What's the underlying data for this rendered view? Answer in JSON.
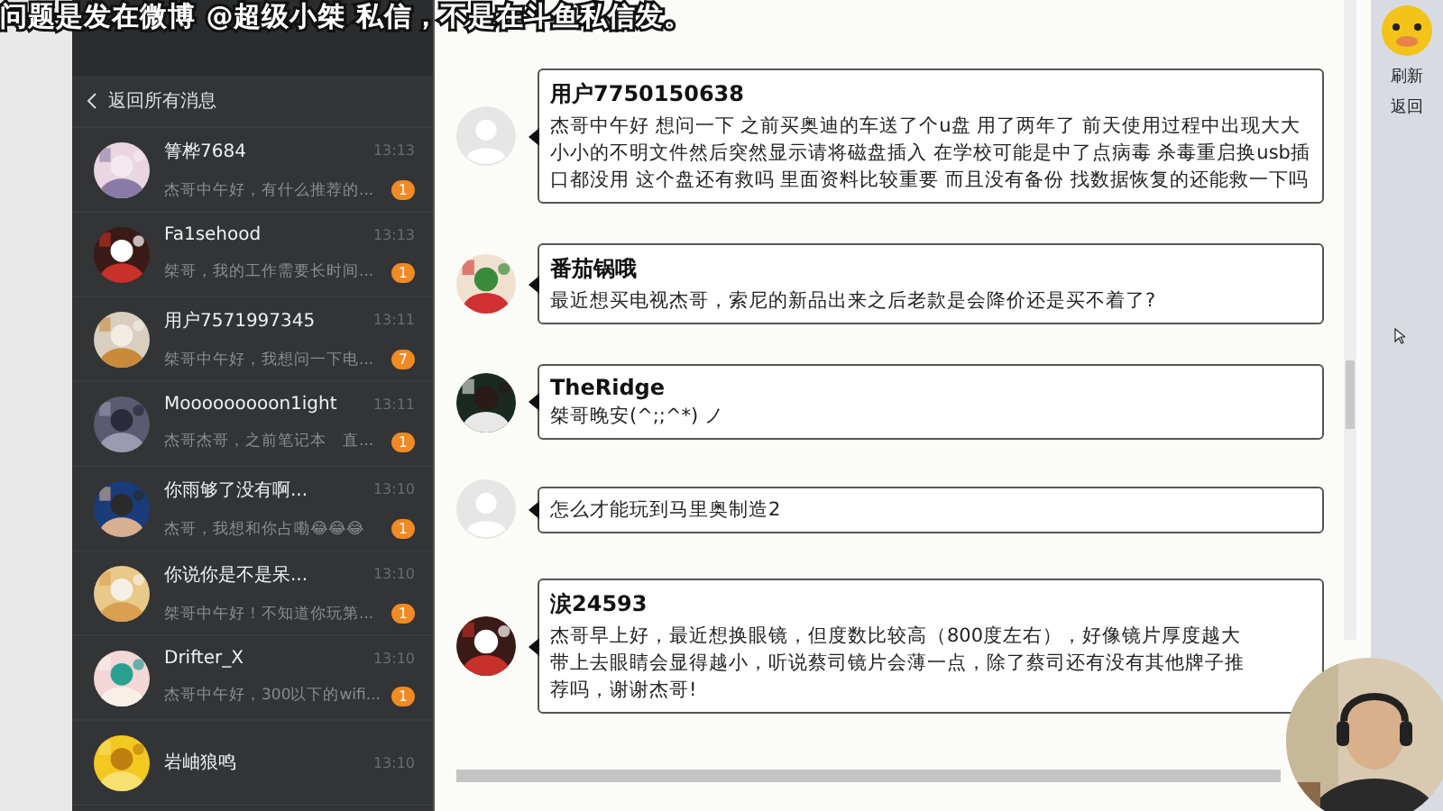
{
  "caption": "问题是发在微博 @超级小桀 私信，不是在斗鱼私信发。",
  "sidebar": {
    "back": "返回所有消息",
    "conversations": [
      {
        "name": "箐桦7684",
        "time": "13:13",
        "preview": "杰哥中午好，有什么推荐的...",
        "unread": "1"
      },
      {
        "name": "Fa1sehood",
        "time": "13:13",
        "preview": "桀哥，我的工作需要长时间...",
        "unread": "1"
      },
      {
        "name": "用户7571997345",
        "time": "13:11",
        "preview": "桀哥中午好，我想问一下电...",
        "unread": "7"
      },
      {
        "name": "Mooooooooon1ight",
        "time": "13:11",
        "preview": "杰哥杰哥，之前笔记本　直...",
        "unread": "1"
      },
      {
        "name": "你雨够了没有啊...",
        "time": "13:10",
        "preview": "杰哥，我想和你占嘞😂😂😂",
        "unread": "1"
      },
      {
        "name": "你说你是不是呆...",
        "time": "13:10",
        "preview": "桀哥中午好！不知道你玩第...",
        "unread": "1"
      },
      {
        "name": "Drifter_X",
        "time": "13:10",
        "preview": "杰哥中午好，300以下的wifi...",
        "unread": "1"
      },
      {
        "name": "岩岫狼鸣",
        "time": "13:10"
      }
    ]
  },
  "messages": [
    {
      "kind": "default",
      "name": "用户7750150638",
      "text": "杰哥中午好 想问一下 之前买奥迪的车送了个u盘 用了两年了 前天使用过程中出现大大小小的不明文件然后突然显示请将磁盘插入  在学校可能是中了点病毒 杀毒重启换usb插口都没用 这个盘还有救吗 里面资料比较重要 而且没有备份 找数据恢复的还能救一下吗"
    },
    {
      "kind": "picture",
      "name": "番茄锅哦",
      "text": "最近想买电视杰哥，索尼的新品出来之后老款是会降价还是买不着了?"
    },
    {
      "kind": "picture",
      "name": "TheRidge",
      "text": "桀哥晚安(^;;^*) ノ"
    },
    {
      "kind": "default",
      "text": "怎么才能玩到马里奥制造2"
    },
    {
      "kind": "picture",
      "name": "涙24593",
      "text": "杰哥早上好，最近想换眼镜，但度数比较高（800度左右），好像镜片厚度越大带上去眼睛会显得越小，听说蔡司镜片会薄一点，除了蔡司还有没有其他牌子推荐吗，谢谢杰哥!"
    }
  ],
  "side_actions": [
    "刷新",
    "返回"
  ]
}
